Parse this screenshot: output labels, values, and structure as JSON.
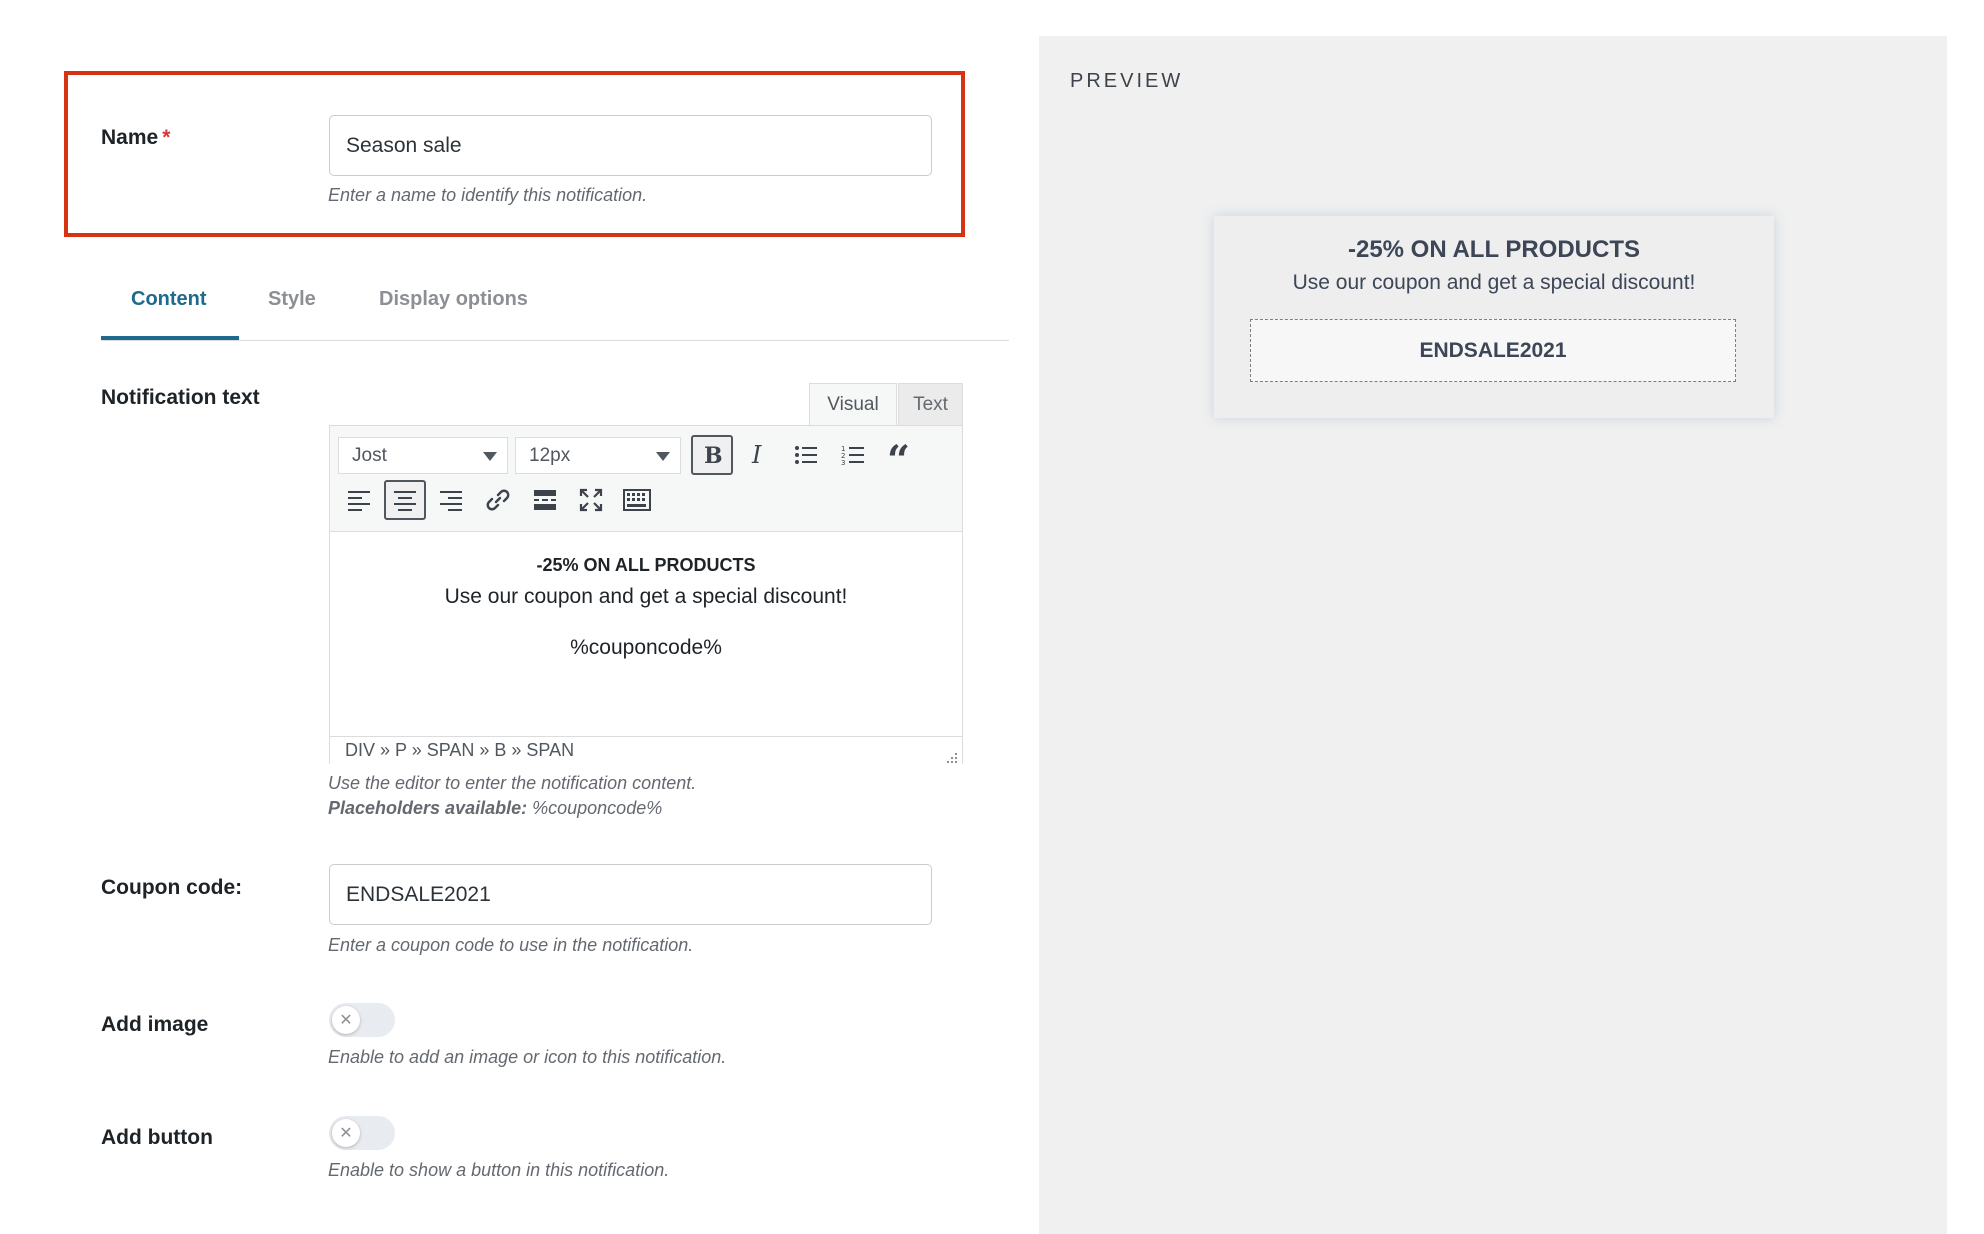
{
  "name_field": {
    "label": "Name",
    "required_mark": "*",
    "value": "Season sale",
    "hint": "Enter a name to identify this notification."
  },
  "tabs": [
    {
      "label": "Content",
      "active": true
    },
    {
      "label": "Style",
      "active": false
    },
    {
      "label": "Display options",
      "active": false
    }
  ],
  "notification_text": {
    "label": "Notification text",
    "mode_tabs": {
      "visual": "Visual",
      "text": "Text"
    },
    "font_select": "Jost",
    "size_select": "12px",
    "toolbar_icons": [
      "bold-icon",
      "italic-icon",
      "bullet-list-icon",
      "numbered-list-icon",
      "blockquote-icon",
      "align-left-icon",
      "align-center-icon",
      "align-right-icon",
      "link-icon",
      "read-more-icon",
      "fullscreen-icon",
      "keyboard-icon"
    ],
    "content": {
      "headline": "-25% ON ALL PRODUCTS",
      "subline": "Use our coupon and get a special discount!",
      "placeholder_line": "%couponcode%"
    },
    "path": "DIV » P » SPAN » B » SPAN",
    "hint": "Use the editor to enter the notification content.",
    "placeholders_label": "Placeholders available:",
    "placeholders_value": "%couponcode%"
  },
  "coupon_field": {
    "label": "Coupon code:",
    "value": "ENDSALE2021",
    "hint": "Enter a coupon code to use in the notification."
  },
  "add_image": {
    "label": "Add image",
    "enabled": false,
    "hint": "Enable to add an image or icon to this notification."
  },
  "add_button": {
    "label": "Add button",
    "enabled": false,
    "hint": "Enable to show a button in this notification."
  },
  "preview": {
    "label": "PREVIEW",
    "title": "-25% ON ALL PRODUCTS",
    "subtitle": "Use our coupon and get a special discount!",
    "coupon": "ENDSALE2021"
  },
  "colors": {
    "highlight_border": "#d63214",
    "accent": "#1e6a8d",
    "required": "#d63638"
  }
}
